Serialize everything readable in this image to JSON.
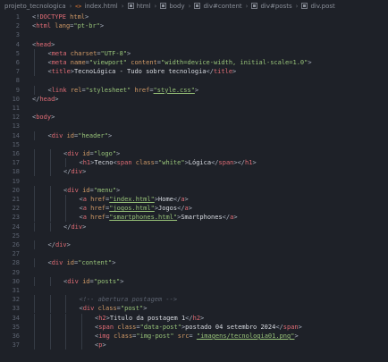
{
  "breadcrumb": {
    "items": [
      "projeto_tecnologica",
      "index.html",
      "html",
      "body",
      "div#content",
      "div#posts",
      "div.post"
    ]
  },
  "editor": {
    "lines": [
      {
        "n": "1",
        "indent": 0,
        "tokens": [
          [
            "p",
            "<!"
          ],
          [
            "t",
            "DOCTYPE"
          ],
          [
            "p",
            " "
          ],
          [
            "a",
            "html"
          ],
          [
            "p",
            ">"
          ]
        ]
      },
      {
        "n": "2",
        "indent": 0,
        "tokens": [
          [
            "p",
            "<"
          ],
          [
            "t",
            "html"
          ],
          [
            "p",
            " "
          ],
          [
            "a",
            "lang"
          ],
          [
            "p",
            "="
          ],
          [
            "s",
            "\"pt-br\""
          ],
          [
            "p",
            ">"
          ]
        ]
      },
      {
        "n": "3",
        "indent": 0,
        "tokens": []
      },
      {
        "n": "4",
        "indent": 0,
        "tokens": [
          [
            "p",
            "<"
          ],
          [
            "t",
            "head"
          ],
          [
            "p",
            ">"
          ]
        ]
      },
      {
        "n": "5",
        "indent": 1,
        "tokens": [
          [
            "p",
            "<"
          ],
          [
            "t",
            "meta"
          ],
          [
            "p",
            " "
          ],
          [
            "a",
            "charset"
          ],
          [
            "p",
            "="
          ],
          [
            "s",
            "\"UTF-8\""
          ],
          [
            "p",
            ">"
          ]
        ]
      },
      {
        "n": "6",
        "indent": 1,
        "tokens": [
          [
            "p",
            "<"
          ],
          [
            "t",
            "meta"
          ],
          [
            "p",
            " "
          ],
          [
            "a",
            "name"
          ],
          [
            "p",
            "="
          ],
          [
            "s",
            "\"viewport\""
          ],
          [
            "p",
            " "
          ],
          [
            "a",
            "content"
          ],
          [
            "p",
            "="
          ],
          [
            "s",
            "\"width=device-width, initial-scale=1.0\""
          ],
          [
            "p",
            ">"
          ]
        ]
      },
      {
        "n": "7",
        "indent": 1,
        "tokens": [
          [
            "p",
            "<"
          ],
          [
            "t",
            "title"
          ],
          [
            "p",
            ">"
          ],
          [
            "tx",
            "TecnoLógica - Tudo sobre tecnologia"
          ],
          [
            "p",
            "</"
          ],
          [
            "t",
            "title"
          ],
          [
            "p",
            ">"
          ]
        ]
      },
      {
        "n": "8",
        "indent": 0,
        "tokens": []
      },
      {
        "n": "9",
        "indent": 1,
        "tokens": [
          [
            "p",
            "<"
          ],
          [
            "t",
            "link"
          ],
          [
            "p",
            " "
          ],
          [
            "a",
            "rel"
          ],
          [
            "p",
            "="
          ],
          [
            "s",
            "\"stylesheet\""
          ],
          [
            "p",
            " "
          ],
          [
            "a",
            "href"
          ],
          [
            "p",
            "="
          ],
          [
            "su",
            "\"style.css\""
          ],
          [
            "p",
            ">"
          ]
        ]
      },
      {
        "n": "10",
        "indent": 0,
        "tokens": [
          [
            "p",
            "</"
          ],
          [
            "t",
            "head"
          ],
          [
            "p",
            ">"
          ]
        ]
      },
      {
        "n": "11",
        "indent": 0,
        "tokens": []
      },
      {
        "n": "12",
        "indent": 0,
        "tokens": [
          [
            "p",
            "<"
          ],
          [
            "t",
            "body"
          ],
          [
            "p",
            ">"
          ]
        ]
      },
      {
        "n": "13",
        "indent": 0,
        "tokens": []
      },
      {
        "n": "14",
        "indent": 1,
        "tokens": [
          [
            "p",
            "<"
          ],
          [
            "t",
            "div"
          ],
          [
            "p",
            " "
          ],
          [
            "a",
            "id"
          ],
          [
            "p",
            "="
          ],
          [
            "s",
            "\"header\""
          ],
          [
            "p",
            ">"
          ]
        ]
      },
      {
        "n": "15",
        "indent": 0,
        "tokens": []
      },
      {
        "n": "16",
        "indent": 2,
        "tokens": [
          [
            "p",
            "<"
          ],
          [
            "t",
            "div"
          ],
          [
            "p",
            " "
          ],
          [
            "a",
            "id"
          ],
          [
            "p",
            "="
          ],
          [
            "s",
            "\"logo\""
          ],
          [
            "p",
            ">"
          ]
        ]
      },
      {
        "n": "17",
        "indent": 3,
        "tokens": [
          [
            "p",
            "<"
          ],
          [
            "t",
            "h1"
          ],
          [
            "p",
            ">"
          ],
          [
            "tx",
            "Tecno"
          ],
          [
            "p",
            "<"
          ],
          [
            "t",
            "span"
          ],
          [
            "p",
            " "
          ],
          [
            "a",
            "class"
          ],
          [
            "p",
            "="
          ],
          [
            "s",
            "\"white\""
          ],
          [
            "p",
            ">"
          ],
          [
            "tx",
            "Lógica"
          ],
          [
            "p",
            "</"
          ],
          [
            "t",
            "span"
          ],
          [
            "p",
            "></"
          ],
          [
            "t",
            "h1"
          ],
          [
            "p",
            ">"
          ]
        ]
      },
      {
        "n": "18",
        "indent": 2,
        "tokens": [
          [
            "p",
            "</"
          ],
          [
            "t",
            "div"
          ],
          [
            "p",
            ">"
          ]
        ]
      },
      {
        "n": "19",
        "indent": 0,
        "tokens": []
      },
      {
        "n": "20",
        "indent": 2,
        "tokens": [
          [
            "p",
            "<"
          ],
          [
            "t",
            "div"
          ],
          [
            "p",
            " "
          ],
          [
            "a",
            "id"
          ],
          [
            "p",
            "="
          ],
          [
            "s",
            "\"menu\""
          ],
          [
            "p",
            ">"
          ]
        ]
      },
      {
        "n": "21",
        "indent": 3,
        "tokens": [
          [
            "p",
            "<"
          ],
          [
            "t",
            "a"
          ],
          [
            "p",
            " "
          ],
          [
            "a",
            "href"
          ],
          [
            "p",
            "="
          ],
          [
            "su",
            "\"index.html\""
          ],
          [
            "p",
            ">"
          ],
          [
            "tx",
            "Home"
          ],
          [
            "p",
            "</"
          ],
          [
            "t",
            "a"
          ],
          [
            "p",
            ">"
          ]
        ]
      },
      {
        "n": "22",
        "indent": 3,
        "tokens": [
          [
            "p",
            "<"
          ],
          [
            "t",
            "a"
          ],
          [
            "p",
            " "
          ],
          [
            "a",
            "href"
          ],
          [
            "p",
            "="
          ],
          [
            "su",
            "\"jogos.html\""
          ],
          [
            "p",
            ">"
          ],
          [
            "tx",
            "Jogos"
          ],
          [
            "p",
            "</"
          ],
          [
            "t",
            "a"
          ],
          [
            "p",
            ">"
          ]
        ]
      },
      {
        "n": "23",
        "indent": 3,
        "tokens": [
          [
            "p",
            "<"
          ],
          [
            "t",
            "a"
          ],
          [
            "p",
            " "
          ],
          [
            "a",
            "href"
          ],
          [
            "p",
            "="
          ],
          [
            "su",
            "\"smartphones.html\""
          ],
          [
            "p",
            ">"
          ],
          [
            "tx",
            "Smartphones"
          ],
          [
            "p",
            "</"
          ],
          [
            "t",
            "a"
          ],
          [
            "p",
            ">"
          ]
        ]
      },
      {
        "n": "24",
        "indent": 2,
        "tokens": [
          [
            "p",
            "</"
          ],
          [
            "t",
            "div"
          ],
          [
            "p",
            ">"
          ]
        ]
      },
      {
        "n": "25",
        "indent": 0,
        "tokens": []
      },
      {
        "n": "26",
        "indent": 1,
        "tokens": [
          [
            "p",
            "</"
          ],
          [
            "t",
            "div"
          ],
          [
            "p",
            ">"
          ]
        ]
      },
      {
        "n": "27",
        "indent": 0,
        "tokens": []
      },
      {
        "n": "28",
        "indent": 1,
        "tokens": [
          [
            "p",
            "<"
          ],
          [
            "t",
            "div"
          ],
          [
            "p",
            " "
          ],
          [
            "a",
            "id"
          ],
          [
            "p",
            "="
          ],
          [
            "s",
            "\"content\""
          ],
          [
            "p",
            ">"
          ]
        ]
      },
      {
        "n": "29",
        "indent": 0,
        "tokens": []
      },
      {
        "n": "30",
        "indent": 2,
        "tokens": [
          [
            "p",
            "<"
          ],
          [
            "t",
            "div"
          ],
          [
            "p",
            " "
          ],
          [
            "a",
            "id"
          ],
          [
            "p",
            "="
          ],
          [
            "s",
            "\"posts\""
          ],
          [
            "p",
            ">"
          ]
        ]
      },
      {
        "n": "31",
        "indent": 0,
        "tokens": []
      },
      {
        "n": "32",
        "indent": 3,
        "tokens": [
          [
            "c",
            "<!-- abertura postagem -->"
          ]
        ]
      },
      {
        "n": "33",
        "indent": 3,
        "tokens": [
          [
            "p",
            "<"
          ],
          [
            "t",
            "div"
          ],
          [
            "p",
            " "
          ],
          [
            "a",
            "class"
          ],
          [
            "p",
            "="
          ],
          [
            "s",
            "\"post\""
          ],
          [
            "p",
            ">"
          ]
        ]
      },
      {
        "n": "34",
        "indent": 4,
        "tokens": [
          [
            "p",
            "<"
          ],
          [
            "t",
            "h2"
          ],
          [
            "p",
            ">"
          ],
          [
            "tx",
            "Titulo da postagem 1"
          ],
          [
            "p",
            "</"
          ],
          [
            "t",
            "h2"
          ],
          [
            "p",
            ">"
          ]
        ]
      },
      {
        "n": "35",
        "indent": 4,
        "tokens": [
          [
            "p",
            "<"
          ],
          [
            "t",
            "span"
          ],
          [
            "p",
            " "
          ],
          [
            "a",
            "class"
          ],
          [
            "p",
            "="
          ],
          [
            "s",
            "\"data-post\""
          ],
          [
            "p",
            ">"
          ],
          [
            "tx",
            "postado 04 setembro 2024"
          ],
          [
            "p",
            "</"
          ],
          [
            "t",
            "span"
          ],
          [
            "p",
            ">"
          ]
        ]
      },
      {
        "n": "36",
        "indent": 4,
        "tokens": [
          [
            "p",
            "<"
          ],
          [
            "t",
            "img"
          ],
          [
            "p",
            " "
          ],
          [
            "a",
            "class"
          ],
          [
            "p",
            "="
          ],
          [
            "s",
            "\"img-post\""
          ],
          [
            "p",
            " "
          ],
          [
            "a",
            "src"
          ],
          [
            "p",
            "= "
          ],
          [
            "su",
            "\"imagens/tecnologia01.png\""
          ],
          [
            "p",
            ">"
          ]
        ]
      },
      {
        "n": "37",
        "indent": 4,
        "tokens": [
          [
            "p",
            "<"
          ],
          [
            "t",
            "p"
          ],
          [
            "p",
            ">"
          ]
        ]
      }
    ]
  }
}
